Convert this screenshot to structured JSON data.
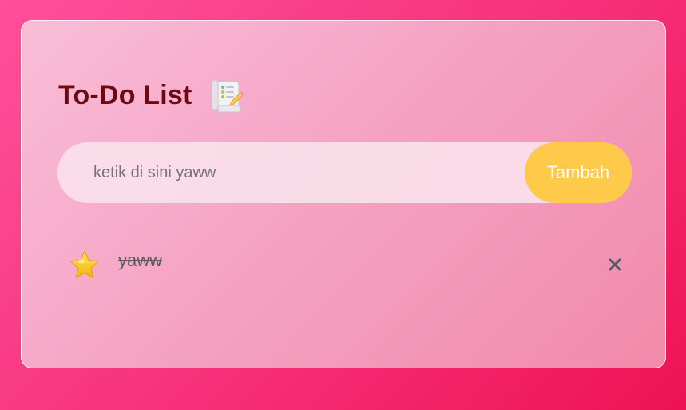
{
  "header": {
    "title": "To-Do List",
    "title_icon": "scroll-icon"
  },
  "input": {
    "placeholder": "ketik di sini yaww",
    "value": ""
  },
  "add_button": {
    "label": "Tambah"
  },
  "tasks": [
    {
      "text": "yaww",
      "completed": true,
      "status_icon": "star-icon",
      "delete_icon": "close-icon"
    }
  ],
  "colors": {
    "background_start": "#ff4f9a",
    "background_end": "#ee1254",
    "title": "#6b0a12",
    "button": "#ffc94a",
    "button_text": "#ffffff",
    "task_text": "#5a5a5a"
  }
}
